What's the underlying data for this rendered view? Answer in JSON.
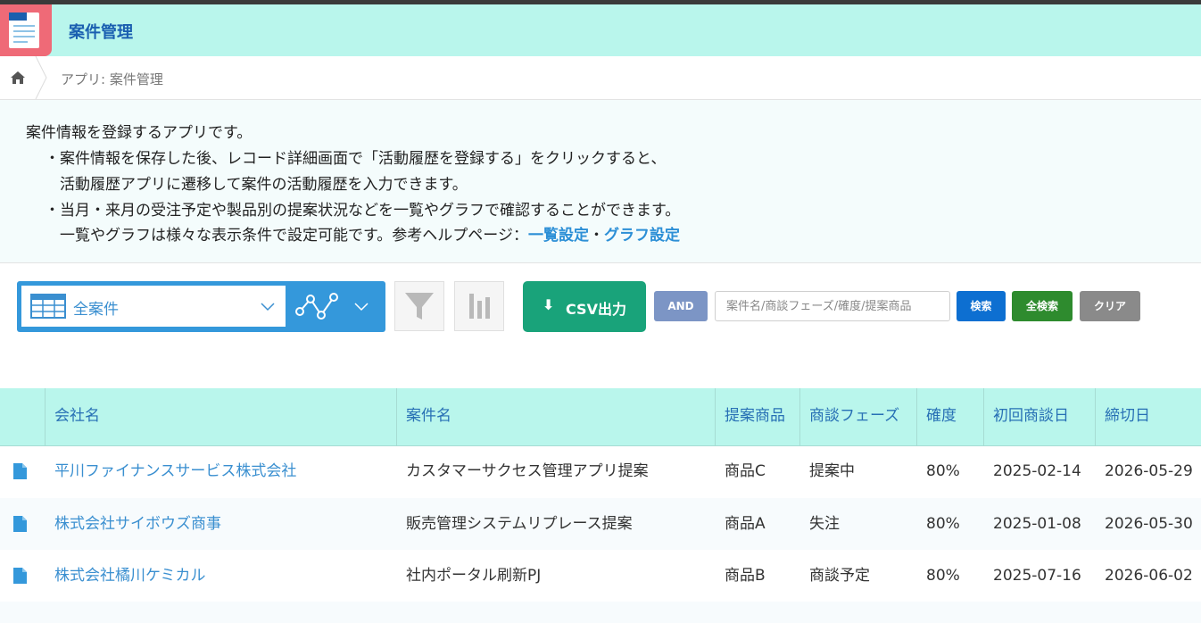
{
  "app": {
    "title": "案件管理"
  },
  "breadcrumb": {
    "text": "アプリ: 案件管理"
  },
  "description": {
    "line1": "案件情報を登録するアプリです。",
    "line2": "・案件情報を保存した後、レコード詳細画面で「活動履歴を登録する」をクリックすると、",
    "line3": "活動履歴アプリに遷移して案件の活動履歴を入力できます。",
    "line4": "・当月・来月の受注予定や製品別の提案状況などを一覧やグラフで確認することができます。",
    "line5": "一覧やグラフは様々な表示条件で設定可能です。参考ヘルプページ：",
    "link1": "一覧設定",
    "sep": "・",
    "link2": "グラフ設定"
  },
  "toolbar": {
    "view_name": "全案件",
    "csv_label": "CSV出力",
    "and_label": "AND",
    "search_placeholder": "案件名/商談フェーズ/確度/提案商品",
    "search_label": "検索",
    "all_search_label": "全検索",
    "clear_label": "クリア"
  },
  "colors": {
    "header_bg": "#b9f6ec",
    "accent_blue": "#3498db",
    "csv_green": "#19a37a",
    "search_blue": "#0d6fd1",
    "all_search_green": "#2e8b2e",
    "clear_gray": "#8a8a8a"
  },
  "table": {
    "headers": [
      "会社名",
      "案件名",
      "提案商品",
      "商談フェーズ",
      "確度",
      "初回商談日",
      "締切日"
    ],
    "rows": [
      {
        "company": "平川ファイナンスサービス株式会社",
        "deal": "カスタマーサクセス管理アプリ提案",
        "product": "商品C",
        "phase": "提案中",
        "prob": "80%",
        "first": "2025-02-14",
        "due": "2026-05-29"
      },
      {
        "company": "株式会社サイボウズ商事",
        "deal": "販売管理システムリプレース提案",
        "product": "商品A",
        "phase": "失注",
        "prob": "80%",
        "first": "2025-01-08",
        "due": "2026-05-30"
      },
      {
        "company": "株式会社橘川ケミカル",
        "deal": "社内ポータル刷新PJ",
        "product": "商品B",
        "phase": "商談予定",
        "prob": "80%",
        "first": "2025-07-16",
        "due": "2026-06-02"
      }
    ]
  }
}
